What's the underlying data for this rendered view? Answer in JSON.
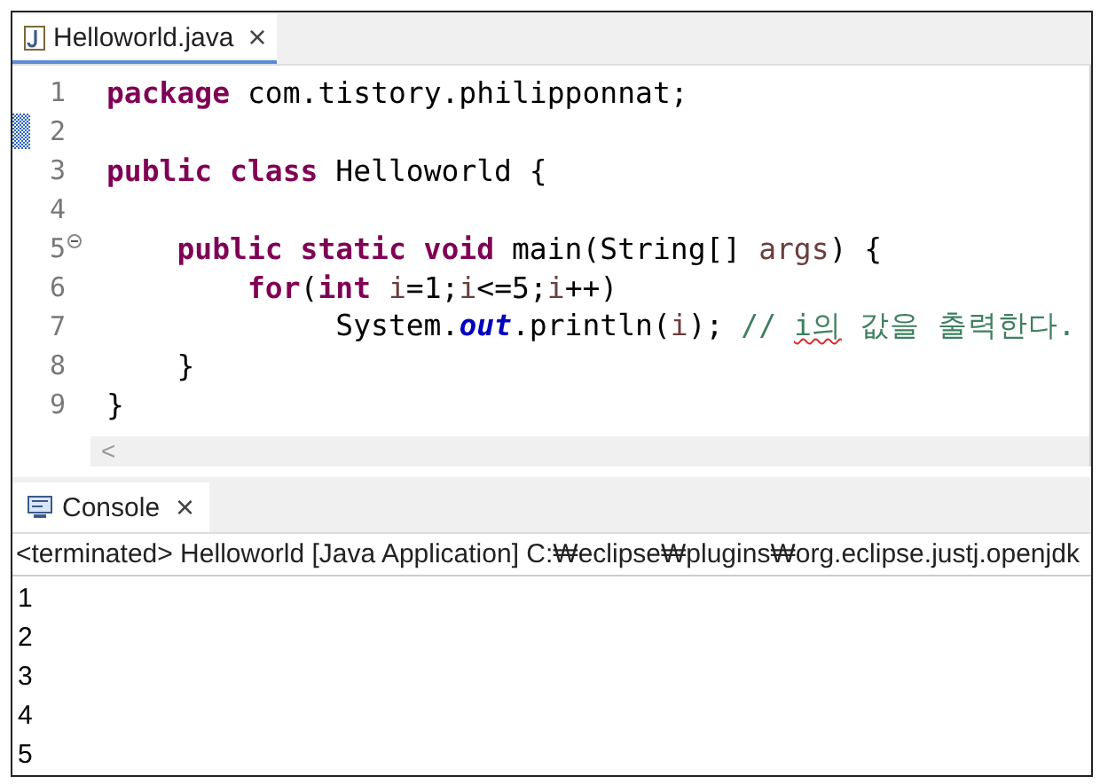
{
  "editor_tab": {
    "title": "Helloworld.java",
    "close": "×"
  },
  "code_lines": [
    {
      "number": "1",
      "tokens": [
        {
          "kind": "keyword",
          "text": "package"
        },
        {
          "kind": "plain",
          "text": " com.tistory.philipponnat;"
        }
      ]
    },
    {
      "number": "2",
      "marked": true
    },
    {
      "number": "3",
      "tokens": [
        {
          "kind": "keyword",
          "text": "public class"
        },
        {
          "kind": "plain",
          "text": " Helloworld {"
        }
      ]
    },
    {
      "number": "4"
    },
    {
      "number": "5",
      "foldable": true,
      "tokens": [
        {
          "kind": "keyword",
          "text": "    public static void"
        },
        {
          "kind": "plain",
          "text": " main(String[] "
        },
        {
          "kind": "variable",
          "text": "args"
        },
        {
          "kind": "plain",
          "text": ") {"
        }
      ]
    },
    {
      "number": "6",
      "tokens": [
        {
          "kind": "keyword",
          "text": "        for"
        },
        {
          "kind": "plain",
          "text": "("
        },
        {
          "kind": "keyword",
          "text": "int "
        },
        {
          "kind": "variable",
          "text": "i"
        },
        {
          "kind": "plain",
          "text": "=1;"
        },
        {
          "kind": "variable",
          "text": "i"
        },
        {
          "kind": "plain",
          "text": "<=5;"
        },
        {
          "kind": "variable",
          "text": "i"
        },
        {
          "kind": "plain",
          "text": "++)"
        }
      ]
    },
    {
      "number": "7",
      "tokens": [
        {
          "kind": "plain",
          "text": "             System."
        },
        {
          "kind": "field",
          "text": "out"
        },
        {
          "kind": "plain",
          "text": ".println("
        },
        {
          "kind": "variable",
          "text": "i"
        },
        {
          "kind": "plain",
          "text": "); "
        },
        {
          "kind": "comment",
          "text": "// "
        },
        {
          "kind": "comment",
          "text": "i의",
          "misspelled": true
        },
        {
          "kind": "comment",
          "text": " 값을 출력한다."
        }
      ]
    },
    {
      "number": "8",
      "tokens": [
        {
          "kind": "plain",
          "text": "    }"
        }
      ]
    },
    {
      "number": "9",
      "tokens": [
        {
          "kind": "plain",
          "text": "}"
        }
      ]
    }
  ],
  "scroll_left": "<",
  "console_tab": {
    "title": "Console",
    "close": "×"
  },
  "console_status": "<terminated> Helloworld [Java Application] C:₩eclipse₩plugins₩org.eclipse.justj.openjdk",
  "console_output": [
    "1",
    "2",
    "3",
    "4",
    "5"
  ]
}
